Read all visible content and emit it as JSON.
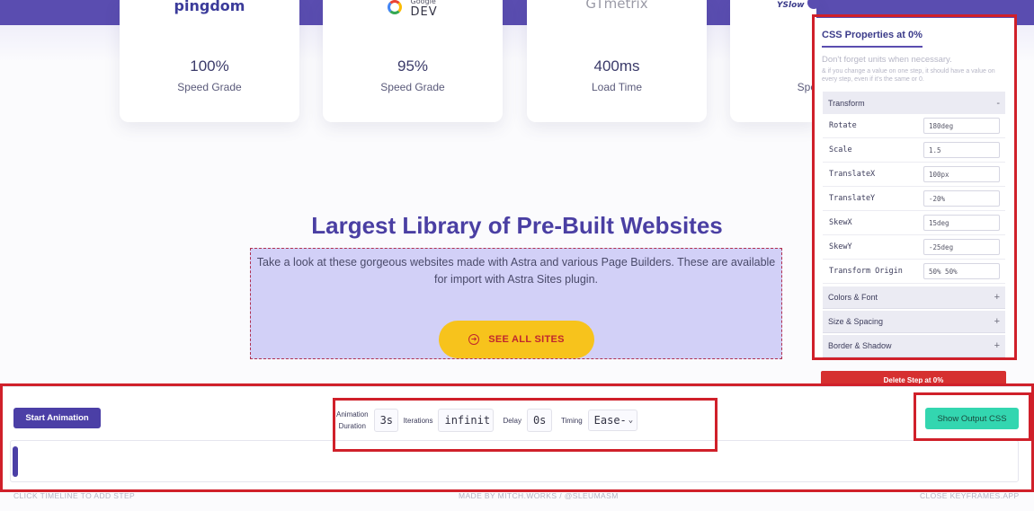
{
  "stats": [
    {
      "logo": "pingdom",
      "value": "100%",
      "label": "Speed Grade"
    },
    {
      "logo_small": "Google",
      "logo": "DEV",
      "value": "95%",
      "label": "Speed Grade"
    },
    {
      "logo": "GTmetrix",
      "value": "400ms",
      "label": "Load Time"
    },
    {
      "logo": "YSlow",
      "value": "",
      "label": "Spe"
    }
  ],
  "hero": {
    "title": "Largest Library of Pre-Built Websites",
    "description": "Take a look at these gorgeous websites made with Astra and various Page Builders. These are available for import with Astra Sites plugin.",
    "button_label": "SEE ALL SITES"
  },
  "panel": {
    "title": "CSS Properties at 0%",
    "hint": "Don't forget units when necessary.",
    "note": "& if you change a value on one step, it should have a value on every step, even if it's the same or 0.",
    "transform": {
      "label": "Transform",
      "sign": "-",
      "properties": [
        {
          "label": "Rotate",
          "value": "180deg"
        },
        {
          "label": "Scale",
          "value": "1.5"
        },
        {
          "label": "TranslateX",
          "value": "100px"
        },
        {
          "label": "TranslateY",
          "value": "-20%"
        },
        {
          "label": "SkewX",
          "value": "15deg"
        },
        {
          "label": "SkewY",
          "value": "-25deg"
        },
        {
          "label": "Transform Origin",
          "value": "50% 50%"
        }
      ]
    },
    "sections": [
      {
        "label": "Colors & Font",
        "sign": "+"
      },
      {
        "label": "Size & Spacing",
        "sign": "+"
      },
      {
        "label": "Border & Shadow",
        "sign": "+"
      }
    ],
    "delete_label": "Delete Step at 0%"
  },
  "toolbar": {
    "start_label": "Start Animation",
    "duration_label_1": "Animation",
    "duration_label_2": "Duration",
    "duration_value": "3s",
    "iterations_label": "Iterations",
    "iterations_value": "infinit",
    "delay_label": "Delay",
    "delay_value": "0s",
    "timing_label": "Timing",
    "timing_value": "Ease-",
    "output_label": "Show Output CSS"
  },
  "footer": {
    "left": "CLICK TIMELINE TO ADD STEP",
    "mid": "MADE BY MITCH.WORKS / @SLEUMASM",
    "right": "CLOSE KEYFRAMES.APP"
  },
  "colors": {
    "brand_purple": "#5a4db0",
    "annotation_red": "#d0202a",
    "button_yellow": "#f7c31c",
    "output_green": "#33d6b0"
  }
}
